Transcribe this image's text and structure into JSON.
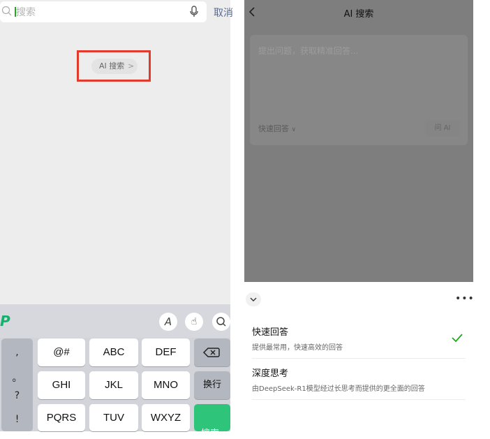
{
  "left": {
    "search": {
      "placeholder": "搜索",
      "cancel": "取消"
    },
    "ai_search_chip": {
      "label": "AI 搜索",
      "chevron": ">"
    },
    "keyboard": {
      "toolbar_icons": [
        "input-method-logo-icon",
        "handwriting-icon",
        "gesture-icon",
        "search-icon"
      ],
      "punct_keys": [
        ",",
        "。",
        "?",
        "!"
      ],
      "rows": [
        [
          "@#",
          "ABC",
          "DEF"
        ],
        [
          "GHI",
          "JKL",
          "MNO"
        ],
        [
          "PQRS",
          "TUV",
          "WXYZ"
        ]
      ],
      "delete_icon": "backspace-icon",
      "newline": "换行",
      "search_key": "搜索",
      "search_key_color": "#2ec47a"
    }
  },
  "right": {
    "header": {
      "title": "AI 搜索",
      "back_icon": "chevron-left-icon"
    },
    "input": {
      "placeholder": "提出问题，获取精准回答...",
      "mode": "快速回答",
      "ask_button": "问 AI"
    },
    "sheet": {
      "collapse_icon": "chevron-down-icon",
      "more_icon": "more-icon",
      "options": [
        {
          "title": "快速回答",
          "desc": "提供最常用，快速高效的回答",
          "selected": true
        },
        {
          "title": "深度思考",
          "desc": "由DeepSeek-R1模型经过长思考而提供的更全面的回答",
          "selected": false
        }
      ],
      "accent_color": "#1aad19"
    }
  },
  "highlight_color": "#e23b2e"
}
